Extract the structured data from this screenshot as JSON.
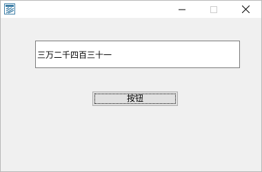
{
  "window": {
    "title": ""
  },
  "titlebar": {
    "app_icon": "app-icon",
    "minimize_icon": "minimize-icon",
    "maximize_icon": "maximize-icon",
    "close_icon": "close-icon",
    "maximize_disabled": true
  },
  "main": {
    "text_field": {
      "value": "三万二千四百三十一"
    },
    "button": {
      "label": "按钮",
      "focused": true
    }
  },
  "colors": {
    "client_background": "#f0f0f0",
    "titlebar_background": "#ffffff",
    "button_face": "#e1e1e1",
    "button_border": "#adadad",
    "input_border": "#7a7a7a",
    "app_icon": "#3a7ca5"
  }
}
